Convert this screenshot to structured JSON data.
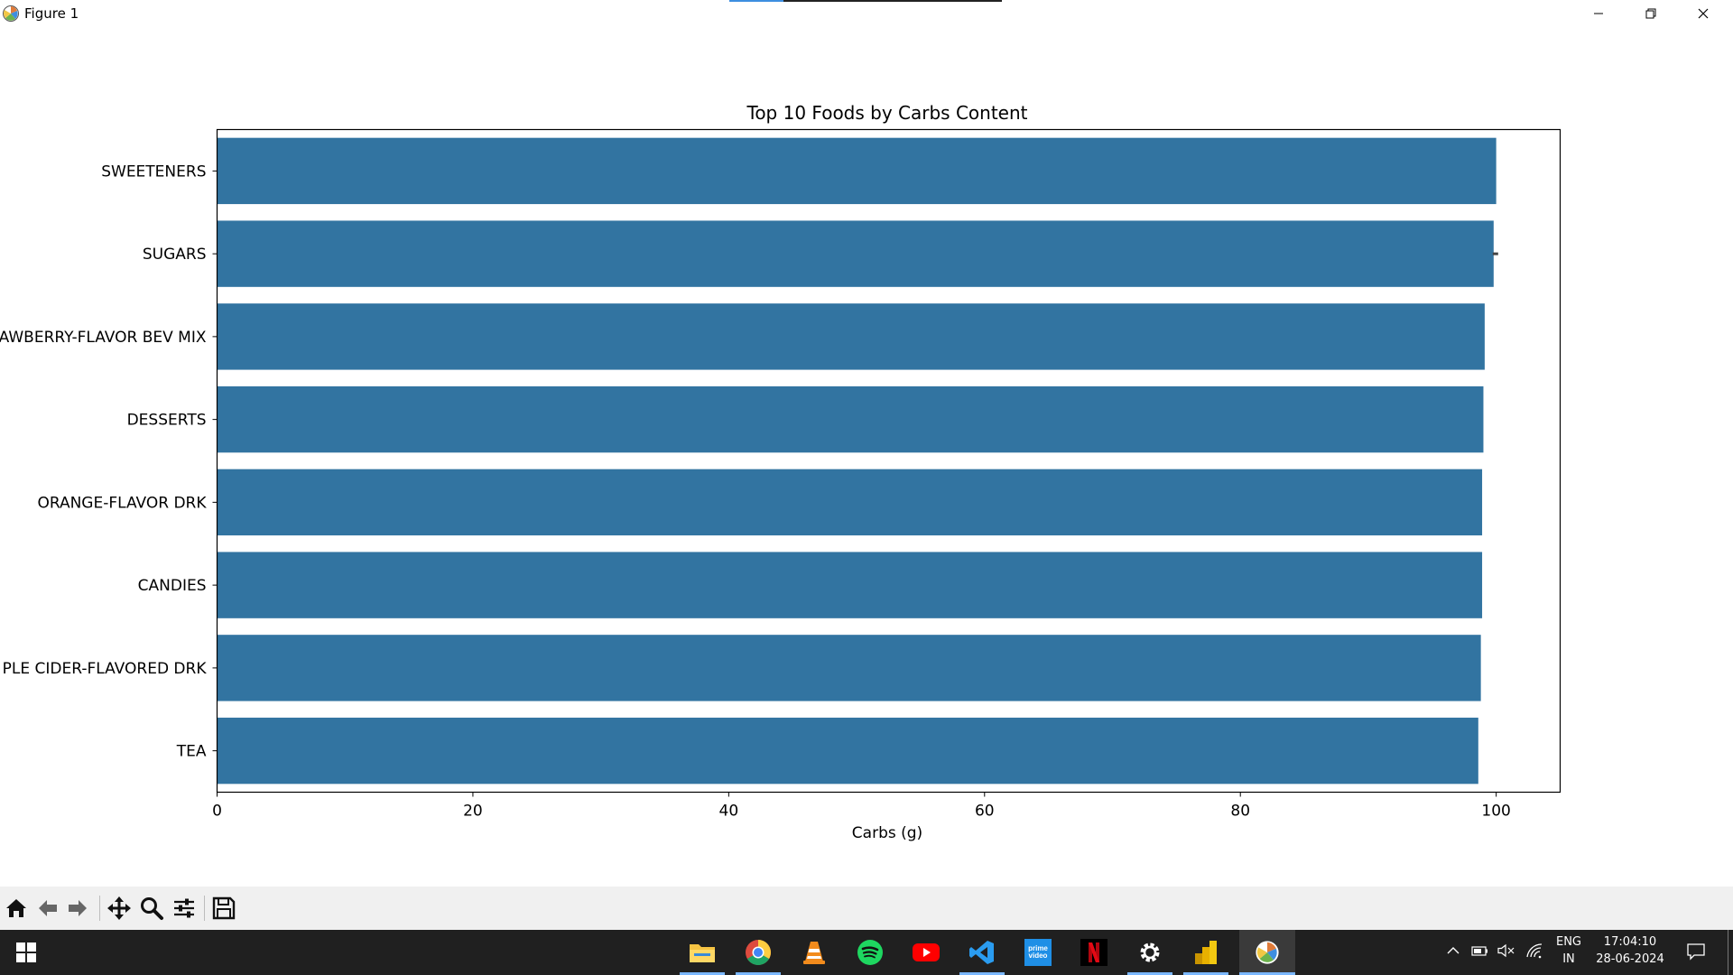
{
  "window": {
    "title": "Figure 1"
  },
  "chart_data": {
    "type": "bar",
    "orientation": "horizontal",
    "title": "Top 10 Foods by Carbs Content",
    "xlabel": "Carbs (g)",
    "ylabel": "",
    "categories": [
      "SWEETENERS",
      "SUGARS",
      "AWBERRY-FLAVOR BEV MIX",
      "DESSERTS",
      "ORANGE-FLAVOR DRK",
      "CANDIES",
      "PLE CIDER-FLAVORED DRK",
      "TEA"
    ],
    "values": [
      100.0,
      99.8,
      99.1,
      99.0,
      98.9,
      98.9,
      98.8,
      98.6
    ],
    "error_bar_categories": [
      "SUGARS"
    ],
    "xlim": [
      0,
      105
    ],
    "xticks": [
      0,
      20,
      40,
      60,
      80,
      100
    ],
    "xtick_labels": [
      "0",
      "20",
      "40",
      "60",
      "80",
      "100"
    ],
    "bar_color": "#3274a1",
    "grid": false
  },
  "toolbar": {
    "buttons": [
      {
        "name": "home-icon"
      },
      {
        "name": "back-arrow-icon"
      },
      {
        "name": "forward-arrow-icon"
      },
      {
        "name": "pan-icon"
      },
      {
        "name": "zoom-icon"
      },
      {
        "name": "configure-subplots-icon"
      },
      {
        "name": "save-icon"
      }
    ]
  },
  "taskbar": {
    "apps": [
      {
        "name": "file-explorer-icon",
        "active": true
      },
      {
        "name": "chrome-icon",
        "active": true
      },
      {
        "name": "vlc-icon",
        "active": false
      },
      {
        "name": "spotify-icon",
        "active": false
      },
      {
        "name": "youtube-icon",
        "active": false
      },
      {
        "name": "vscode-icon",
        "active": true
      },
      {
        "name": "prime-video-icon",
        "active": false
      },
      {
        "name": "netflix-icon",
        "active": false
      },
      {
        "name": "settings-icon",
        "active": true
      },
      {
        "name": "power-bi-icon",
        "active": true
      },
      {
        "name": "matplotlib-icon",
        "active": true
      }
    ],
    "prime_label": "prime video",
    "language": "ENG",
    "region": "IN",
    "time": "17:04:10",
    "date": "28-06-2024"
  }
}
